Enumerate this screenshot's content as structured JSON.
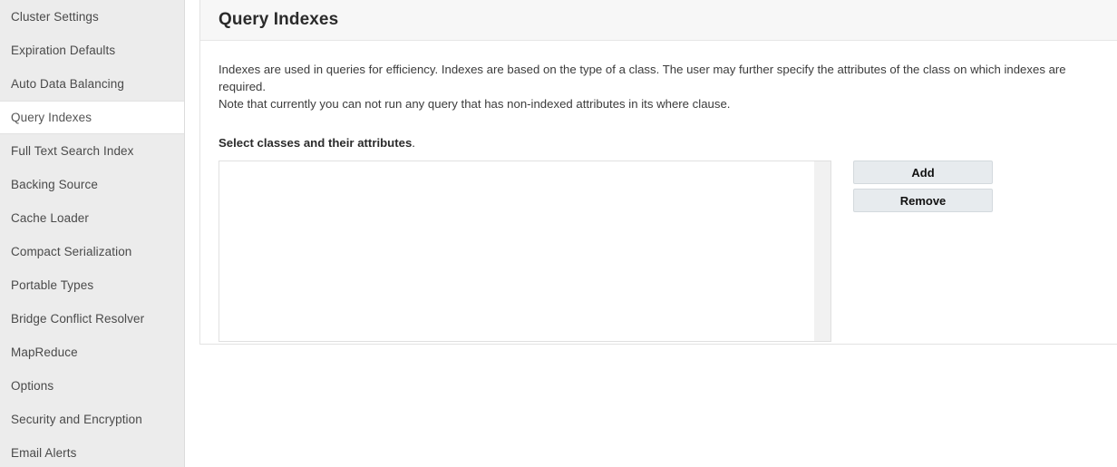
{
  "sidebar": {
    "items": [
      {
        "label": "Cluster Settings",
        "selected": false
      },
      {
        "label": "Expiration Defaults",
        "selected": false
      },
      {
        "label": "Auto Data Balancing",
        "selected": false
      },
      {
        "label": "Query Indexes",
        "selected": true
      },
      {
        "label": "Full Text Search Index",
        "selected": false
      },
      {
        "label": "Backing Source",
        "selected": false
      },
      {
        "label": "Cache Loader",
        "selected": false
      },
      {
        "label": "Compact Serialization",
        "selected": false
      },
      {
        "label": "Portable Types",
        "selected": false
      },
      {
        "label": "Bridge Conflict Resolver",
        "selected": false
      },
      {
        "label": "MapReduce",
        "selected": false
      },
      {
        "label": "Options",
        "selected": false
      },
      {
        "label": "Security and Encryption",
        "selected": false
      },
      {
        "label": "Email Alerts",
        "selected": false
      }
    ]
  },
  "header": {
    "title": "Query Indexes"
  },
  "main": {
    "description_line1": "Indexes are used in queries for efficiency. Indexes are based on the type of a class. The user may further specify the attributes of the class on which indexes are required.",
    "description_line2": "Note that currently you can not run any query that has non-indexed attributes in its where clause.",
    "section_label": "Select classes and their attributes",
    "section_label_punctuation": ".",
    "listbox": {
      "items": [],
      "scrollbar": "vertical-scroll-track"
    },
    "buttons": [
      {
        "label": "Add",
        "name": "add-button"
      },
      {
        "label": "Remove",
        "name": "remove-button"
      }
    ]
  },
  "colors": {
    "sidebar_background": "#ececec",
    "selected_item_background": "#ffffff",
    "card_header_background": "#f7f7f7",
    "button_background": "#e7ebee",
    "button_border": "#d3d9dd",
    "text_primary": "#3b3b3b"
  }
}
